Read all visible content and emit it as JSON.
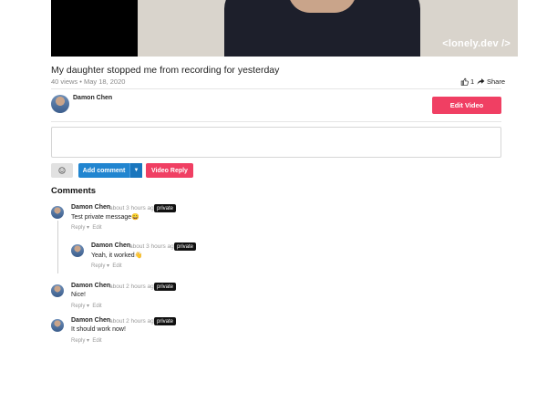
{
  "video": {
    "watermark": "<lonely.dev />",
    "title": "My daughter stopped me from recording for yesterday",
    "meta": "40 views • May 18, 2020",
    "likes": "1",
    "share_label": "Share"
  },
  "owner": {
    "name": "Damon Chen",
    "edit_label": "Edit Video"
  },
  "composer": {
    "placeholder": "",
    "emoji_icon": "smiley-icon",
    "add_comment_label": "Add comment",
    "video_reply_label": "Video Reply"
  },
  "comments_heading": "Comments",
  "comments": [
    {
      "author": "Damon Chen",
      "time": "about 3 hours ago",
      "badge": "private",
      "text": "Test private message😄",
      "reply": "Reply ▾",
      "edit": "Edit"
    },
    {
      "author": "Damon Chen",
      "time": "about 3 hours ago",
      "badge": "private",
      "text": "Yeah, it worked👋",
      "reply": "Reply ▾",
      "edit": "Edit"
    },
    {
      "author": "Damon Chen",
      "time": "about 2 hours ago",
      "badge": "private",
      "text": "Nice!",
      "reply": "Reply ▾",
      "edit": "Edit"
    },
    {
      "author": "Damon Chen",
      "time": "about 2 hours ago",
      "badge": "private",
      "text": "It should work now!",
      "reply": "Reply ▾",
      "edit": "Edit"
    }
  ],
  "colors": {
    "accent_red": "#f03f63",
    "accent_blue": "#2185d0",
    "badge_black": "#111111"
  }
}
